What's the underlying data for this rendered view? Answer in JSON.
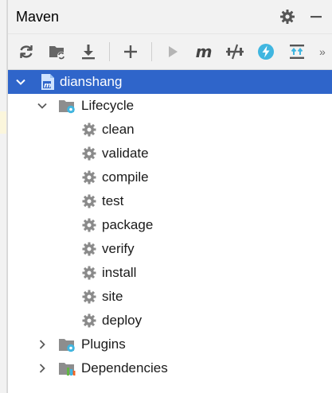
{
  "panel": {
    "title": "Maven",
    "settings_icon": "gear-icon",
    "hide_icon": "minus-icon"
  },
  "toolbar": {
    "buttons": [
      {
        "name": "reload-icon"
      },
      {
        "name": "generate-sources-icon"
      },
      {
        "name": "download-icon"
      },
      {
        "name": "add-icon"
      },
      {
        "name": "run-icon"
      },
      {
        "name": "execute-goal-icon"
      },
      {
        "name": "toggle-offline-icon"
      },
      {
        "name": "skip-tests-icon"
      },
      {
        "name": "show-dependencies-icon"
      }
    ],
    "more": "»"
  },
  "tree": {
    "project": "dianshang",
    "lifecycle": {
      "label": "Lifecycle",
      "goals": [
        "clean",
        "validate",
        "compile",
        "test",
        "package",
        "verify",
        "install",
        "site",
        "deploy"
      ]
    },
    "plugins": "Plugins",
    "dependencies": "Dependencies"
  },
  "colors": {
    "selection": "#2f65ca",
    "icon_gray": "#6e6e6e",
    "accent_blue": "#40b6e0"
  }
}
